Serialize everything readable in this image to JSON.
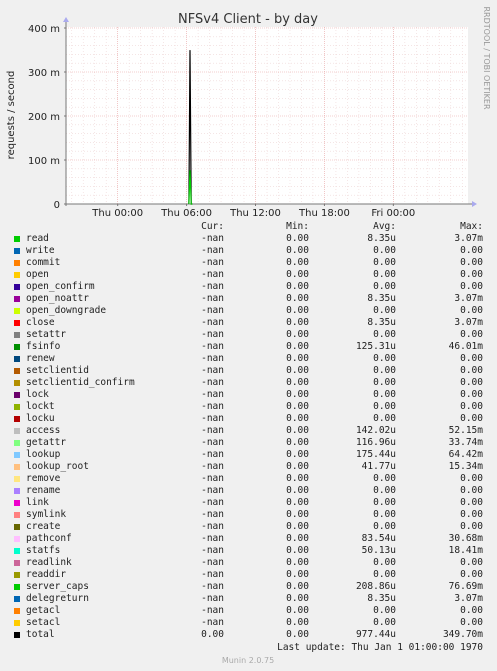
{
  "chart_data": {
    "type": "line",
    "title": "NFSv4 Client - by day",
    "ylabel": "requests / second",
    "side_label": "RRDTOOL / TOBI OETIKER",
    "ylim": [
      0,
      400
    ],
    "y_ticks": [
      "0",
      "100 m",
      "200 m",
      "300 m",
      "400 m"
    ],
    "y_tick_values": [
      0,
      100,
      200,
      300,
      400
    ],
    "x_ticks": [
      "Thu 00:00",
      "Thu 06:00",
      "Thu 12:00",
      "Thu 18:00",
      "Fri 00:00"
    ],
    "x_tick_hours": [
      0,
      6,
      12,
      18,
      24
    ],
    "xlim_hours": [
      -4.5,
      30.5
    ],
    "grid": true,
    "series": [
      {
        "name": "total",
        "color": "#000000",
        "x_hours": [
          6.2,
          6.3,
          6.4,
          6.5
        ],
        "values": [
          0,
          349.7,
          0,
          0
        ]
      },
      {
        "name": "server_caps",
        "color": "#00cc00",
        "x_hours": [
          6.2,
          6.3,
          6.4,
          6.5
        ],
        "values": [
          0,
          76.69,
          0,
          0
        ]
      }
    ]
  },
  "legend": {
    "headers": {
      "cur": "Cur:",
      "min": "Min:",
      "avg": "Avg:",
      "max": "Max:"
    },
    "rows": [
      {
        "name": "read",
        "color": "#00cc00",
        "cur": "-nan",
        "min": "0.00",
        "avg": "8.35u",
        "max": "3.07m"
      },
      {
        "name": "write",
        "color": "#0066b3",
        "cur": "-nan",
        "min": "0.00",
        "avg": "0.00",
        "max": "0.00"
      },
      {
        "name": "commit",
        "color": "#ff8000",
        "cur": "-nan",
        "min": "0.00",
        "avg": "0.00",
        "max": "0.00"
      },
      {
        "name": "open",
        "color": "#ffcc00",
        "cur": "-nan",
        "min": "0.00",
        "avg": "0.00",
        "max": "0.00"
      },
      {
        "name": "open_confirm",
        "color": "#330099",
        "cur": "-nan",
        "min": "0.00",
        "avg": "0.00",
        "max": "0.00"
      },
      {
        "name": "open_noattr",
        "color": "#990099",
        "cur": "-nan",
        "min": "0.00",
        "avg": "8.35u",
        "max": "3.07m"
      },
      {
        "name": "open_downgrade",
        "color": "#ccff00",
        "cur": "-nan",
        "min": "0.00",
        "avg": "0.00",
        "max": "0.00"
      },
      {
        "name": "close",
        "color": "#ff0000",
        "cur": "-nan",
        "min": "0.00",
        "avg": "8.35u",
        "max": "3.07m"
      },
      {
        "name": "setattr",
        "color": "#808080",
        "cur": "-nan",
        "min": "0.00",
        "avg": "0.00",
        "max": "0.00"
      },
      {
        "name": "fsinfo",
        "color": "#008f00",
        "cur": "-nan",
        "min": "0.00",
        "avg": "125.31u",
        "max": "46.01m"
      },
      {
        "name": "renew",
        "color": "#00487d",
        "cur": "-nan",
        "min": "0.00",
        "avg": "0.00",
        "max": "0.00"
      },
      {
        "name": "setclientid",
        "color": "#b35a00",
        "cur": "-nan",
        "min": "0.00",
        "avg": "0.00",
        "max": "0.00"
      },
      {
        "name": "setclientid_confirm",
        "color": "#b38f00",
        "cur": "-nan",
        "min": "0.00",
        "avg": "0.00",
        "max": "0.00"
      },
      {
        "name": "lock",
        "color": "#6b006b",
        "cur": "-nan",
        "min": "0.00",
        "avg": "0.00",
        "max": "0.00"
      },
      {
        "name": "lockt",
        "color": "#8fb300",
        "cur": "-nan",
        "min": "0.00",
        "avg": "0.00",
        "max": "0.00"
      },
      {
        "name": "locku",
        "color": "#b30000",
        "cur": "-nan",
        "min": "0.00",
        "avg": "0.00",
        "max": "0.00"
      },
      {
        "name": "access",
        "color": "#bebebe",
        "cur": "-nan",
        "min": "0.00",
        "avg": "142.02u",
        "max": "52.15m"
      },
      {
        "name": "getattr",
        "color": "#80ff80",
        "cur": "-nan",
        "min": "0.00",
        "avg": "116.96u",
        "max": "33.74m"
      },
      {
        "name": "lookup",
        "color": "#80c9ff",
        "cur": "-nan",
        "min": "0.00",
        "avg": "175.44u",
        "max": "64.42m"
      },
      {
        "name": "lookup_root",
        "color": "#ffc080",
        "cur": "-nan",
        "min": "0.00",
        "avg": "41.77u",
        "max": "15.34m"
      },
      {
        "name": "remove",
        "color": "#ffe680",
        "cur": "-nan",
        "min": "0.00",
        "avg": "0.00",
        "max": "0.00"
      },
      {
        "name": "rename",
        "color": "#aa80ff",
        "cur": "-nan",
        "min": "0.00",
        "avg": "0.00",
        "max": "0.00"
      },
      {
        "name": "link",
        "color": "#ee00cc",
        "cur": "-nan",
        "min": "0.00",
        "avg": "0.00",
        "max": "0.00"
      },
      {
        "name": "symlink",
        "color": "#ff8080",
        "cur": "-nan",
        "min": "0.00",
        "avg": "0.00",
        "max": "0.00"
      },
      {
        "name": "create",
        "color": "#666600",
        "cur": "-nan",
        "min": "0.00",
        "avg": "0.00",
        "max": "0.00"
      },
      {
        "name": "pathconf",
        "color": "#ffbfff",
        "cur": "-nan",
        "min": "0.00",
        "avg": "83.54u",
        "max": "30.68m"
      },
      {
        "name": "statfs",
        "color": "#00ffcc",
        "cur": "-nan",
        "min": "0.00",
        "avg": "50.13u",
        "max": "18.41m"
      },
      {
        "name": "readlink",
        "color": "#cc6699",
        "cur": "-nan",
        "min": "0.00",
        "avg": "0.00",
        "max": "0.00"
      },
      {
        "name": "readdir",
        "color": "#999900",
        "cur": "-nan",
        "min": "0.00",
        "avg": "0.00",
        "max": "0.00"
      },
      {
        "name": "server_caps",
        "color": "#00cc00",
        "cur": "-nan",
        "min": "0.00",
        "avg": "208.86u",
        "max": "76.69m"
      },
      {
        "name": "delegreturn",
        "color": "#0066b3",
        "cur": "-nan",
        "min": "0.00",
        "avg": "8.35u",
        "max": "3.07m"
      },
      {
        "name": "getacl",
        "color": "#ff8000",
        "cur": "-nan",
        "min": "0.00",
        "avg": "0.00",
        "max": "0.00"
      },
      {
        "name": "setacl",
        "color": "#ffcc00",
        "cur": "-nan",
        "min": "0.00",
        "avg": "0.00",
        "max": "0.00"
      },
      {
        "name": "total",
        "color": "#000000",
        "cur": "0.00",
        "min": "0.00",
        "avg": "977.44u",
        "max": "349.70m"
      }
    ]
  },
  "last_update": "Last update: Thu Jan  1 01:00:00 1970",
  "footer": "Munin 2.0.75"
}
